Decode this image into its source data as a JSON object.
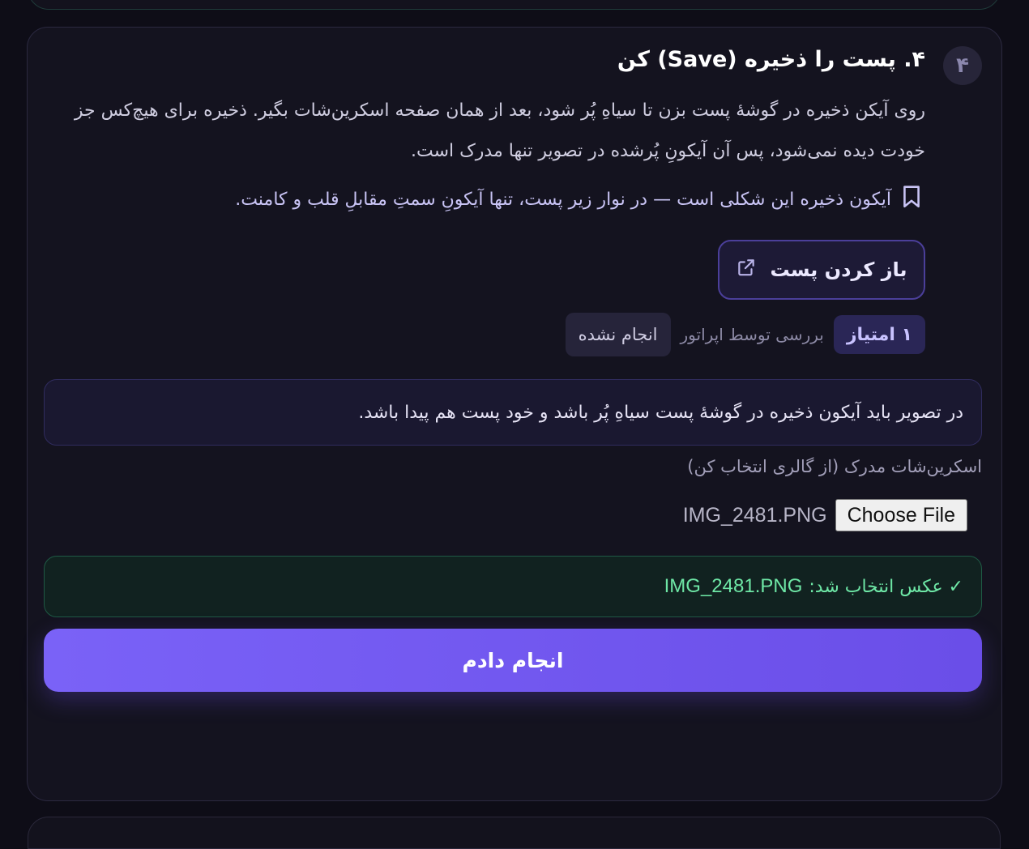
{
  "step": {
    "number": "۴",
    "title": "۴. پست را ذخیره (Save) کن",
    "description": "روی آیکن ذخیره در گوشهٔ پست بزن تا سیاهِ پُر شود، بعد از همان صفحه اسکرین‌شات بگیر. ذخیره برای هیچ‌کس جز خودت دیده نمی‌شود، پس آن آیکونِ پُرشده در تصویر تنها مدرک است.",
    "hint": "آیکون ذخیره این شکلی است — در نوار زیر پست، تنها آیکونِ سمتِ مقابلِ قلب و کامنت.",
    "hint_icon": "bookmark-icon",
    "open_post_label": "باز کردن پست",
    "open_post_icon": "external-link-icon",
    "points": "۱ امتیاز",
    "reviewer": "بررسی توسط اپراتور",
    "status": "انجام نشده",
    "criteria": "در تصویر باید آیکون ذخیره در گوشهٔ پست سیاهِ پُر باشد و خود پست هم پیدا باشد.",
    "upload_label": "اسکرین‌شات مدرک (از گالری انتخاب کن)",
    "choose_file_label": "Choose File",
    "file_name": "IMG_2481.PNG",
    "selected_prefix": "✓ عکس انتخاب شد:",
    "selected_file": "IMG_2481.PNG",
    "done_label": "انجام دادم"
  },
  "colors": {
    "background": "#0e0d17",
    "card": "#14131f",
    "accent": "#7a62f7",
    "success": "#6ee7a6"
  }
}
